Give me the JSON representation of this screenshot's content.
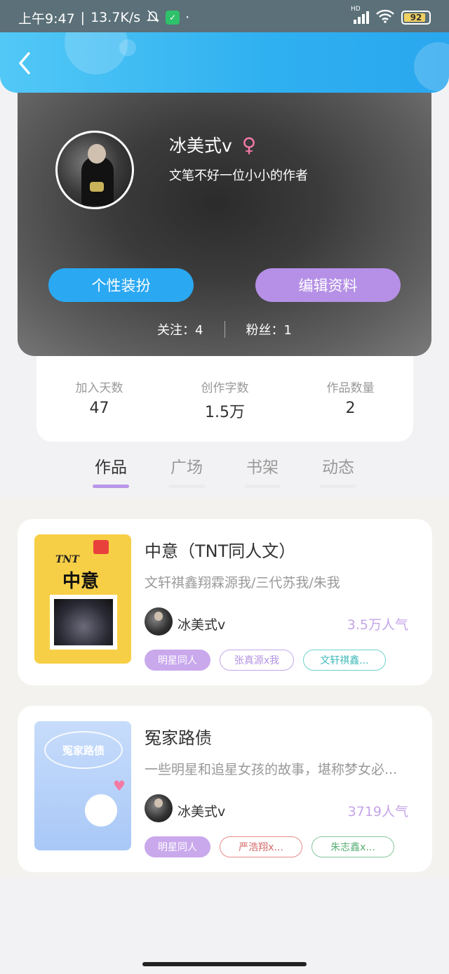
{
  "status_bar": {
    "time": "上午9:47",
    "network_speed": "13.7K/s",
    "dot": "·",
    "hd": "HD",
    "battery": "92"
  },
  "profile": {
    "name": "冰美式v",
    "gender_symbol": "♀",
    "bio": "文笔不好一位小小的作者",
    "style_button": "个性装扮",
    "edit_button": "编辑资料",
    "following": "关注：4",
    "followers": "粉丝：1"
  },
  "stats": [
    {
      "label": "加入天数",
      "value": "47"
    },
    {
      "label": "创作字数",
      "value": "1.5万"
    },
    {
      "label": "作品数量",
      "value": "2"
    }
  ],
  "tabs": [
    {
      "label": "作品",
      "active": true
    },
    {
      "label": "广场",
      "active": false
    },
    {
      "label": "书架",
      "active": false
    },
    {
      "label": "动态",
      "active": false
    }
  ],
  "works": [
    {
      "title": "中意（TNT同人文）",
      "desc": "文轩祺鑫翔霖源我/三代苏我/朱我",
      "author": "冰美式v",
      "popularity": "3.5万人气",
      "cover_text": "中意",
      "cover_tag": "TNT",
      "tags": [
        "明星同人",
        "张真源x我",
        "文轩祺鑫..."
      ]
    },
    {
      "title": "冤家路债",
      "desc": "一些明星和追星女孩的故事，堪称梦女必...",
      "author": "冰美式v",
      "popularity": "3719人气",
      "cover_text": "冤家路债",
      "tags": [
        "明星同人",
        "严浩翔x...",
        "朱志鑫x..."
      ]
    }
  ],
  "colors": {
    "nav_blue": "#2fb0f0",
    "accent_purple": "#b590e6",
    "style_blue": "#2aa8f2",
    "popularity_purple": "#c4a5e8"
  }
}
